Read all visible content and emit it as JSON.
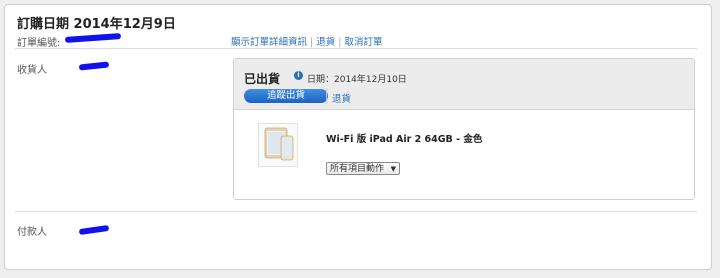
{
  "header": {
    "order_date": "訂購日期 2014年12月9日",
    "order_number_label": "訂單編號:"
  },
  "links": {
    "details": "顯示訂單詳細資訊",
    "return": "退貨",
    "cancel": "取消訂單"
  },
  "recipient": {
    "label": "收貨人"
  },
  "payer": {
    "label": "付款人"
  },
  "shipment": {
    "status": "已出貨",
    "date": "日期：2014年12月10日",
    "track_button": "追蹤出貨",
    "return_link": "退貨"
  },
  "product": {
    "name": "Wi-Fi 版 iPad Air 2 64GB - 金色",
    "action_select": "所有項目動作"
  },
  "colors": {
    "link": "#2a6ebb",
    "button": "#1b63c4",
    "redaction": "#1111ee"
  }
}
